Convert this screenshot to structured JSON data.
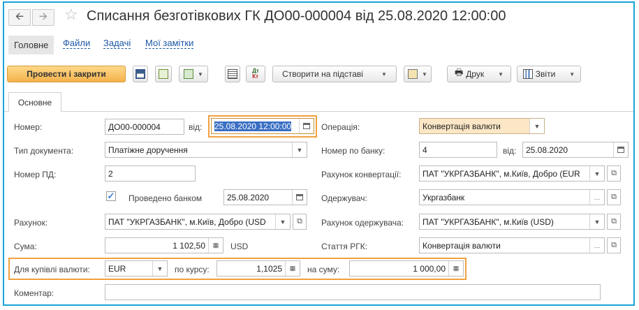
{
  "header": {
    "back_icon": "arrow-left-icon",
    "forward_icon": "arrow-right-icon",
    "title": "Списання безготівкових ГК ДО00-000004 від 25.08.2020 12:00:00"
  },
  "nav": {
    "main": "Головне",
    "files": "Файли",
    "tasks": "Задачі",
    "notes": "Мої замітки"
  },
  "toolbar": {
    "post_close": "Провести і закрити",
    "create_based": "Створити на підставі",
    "print": "Друк",
    "reports": "Звіти"
  },
  "tabs": {
    "main": "Основне"
  },
  "form": {
    "number_label": "Номер:",
    "number_value": "ДО00-000004",
    "from_label": "від:",
    "date_value": "25.08.2020 12:00:00",
    "operation_label": "Операція:",
    "operation_value": "Конвертація валюти",
    "doc_type_label": "Тип документа:",
    "doc_type_value": "Платіжне доручення",
    "bank_no_label": "Номер по банку:",
    "bank_no_value": "4",
    "bank_from_label": "від:",
    "bank_date_value": "25.08.2020",
    "pd_label": "Номер ПД:",
    "pd_value": "2",
    "conv_account_label": "Рахунок конвертації:",
    "conv_account_value": "ПАТ \"УКРГАЗБАНК\", м.Київ, Добро (EUR",
    "bank_posted_label": "Проведено банком",
    "bank_posted_date": "25.08.2020",
    "recipient_label": "Одержувач:",
    "recipient_value": "Укргазбанк",
    "account_label": "Рахунок:",
    "account_value": "ПАТ \"УКРГАЗБАНК\", м.Київ, Добро (USD",
    "recipient_account_label": "Рахунок одержувача:",
    "recipient_account_value": "ПАТ \"УКРГАЗБАНК\", м.Київ (USD)",
    "sum_label": "Сума:",
    "sum_value": "1 102,50",
    "sum_currency": "USD",
    "rgk_label": "Стаття РГК:",
    "rgk_value": "Конвертація валюти",
    "buy_currency_label": "Для купівлі валюти:",
    "buy_currency_value": "EUR",
    "rate_label": "по курсу:",
    "rate_value": "1,1025",
    "amount_label": "на суму:",
    "amount_value": "1 000,00",
    "comment_label": "Коментар:",
    "comment_value": ""
  }
}
